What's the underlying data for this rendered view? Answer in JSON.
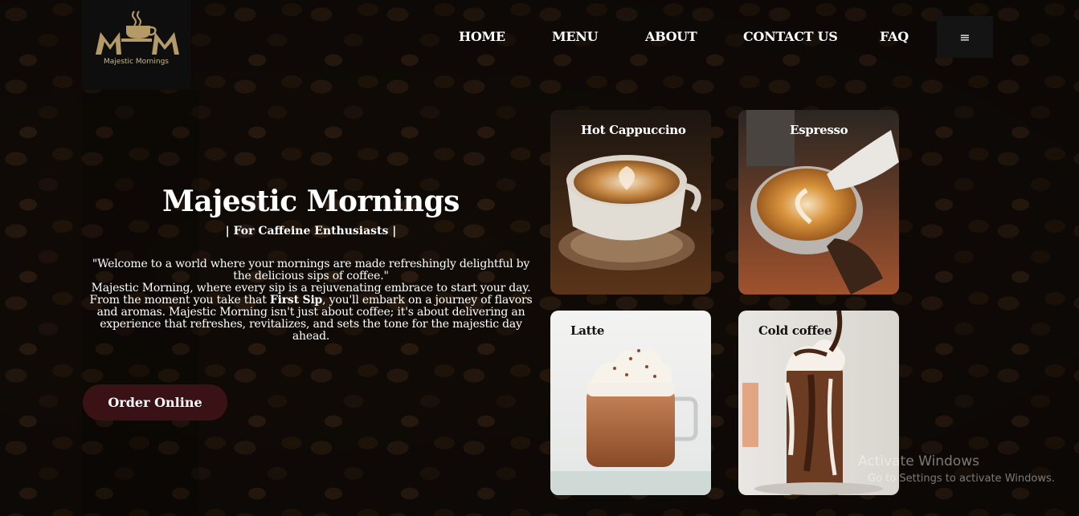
{
  "logo": {
    "mark_text": "MM",
    "caption": "Majestic Mornings"
  },
  "nav": {
    "items": [
      {
        "label": "HOME"
      },
      {
        "label": "MENU"
      },
      {
        "label": "ABOUT"
      },
      {
        "label": "CONTACT US"
      },
      {
        "label": "FAQ"
      }
    ],
    "menu_icon": "hamburger-icon",
    "menu_glyph": "≡"
  },
  "hero": {
    "title": "Majestic Mornings",
    "subtitle": "| For Caffeine Enthusiasts |",
    "quote": "\"Welcome to a world where your mornings are made refreshingly delightful by the delicious sips of coffee.\"",
    "body_before": "Majestic Morning, where every sip is a rejuvenating embrace to start your day. From the moment you take that ",
    "body_strong": "First Sip",
    "body_after": ", you'll embark on a journey of flavors and aromas. Majestic Morning isn't just about coffee; it's about delivering an experience that refreshes, revitalizes, and sets the tone for the majestic day ahead.",
    "cta": "Order Online"
  },
  "cards": [
    {
      "label": "Hot Cappuccino",
      "icon": "cappuccino-cup-icon"
    },
    {
      "label": "Espresso",
      "icon": "espresso-pour-icon"
    },
    {
      "label": "Latte",
      "icon": "latte-glass-icon"
    },
    {
      "label": "Cold coffee",
      "icon": "cold-coffee-glass-icon"
    }
  ],
  "watermark": {
    "line1": "Activate Windows",
    "line2": "Go to Settings to activate Windows."
  },
  "colors": {
    "background": "#1a110b",
    "logo_gold": "#b39a67",
    "cta_bg": "#3a1115"
  }
}
